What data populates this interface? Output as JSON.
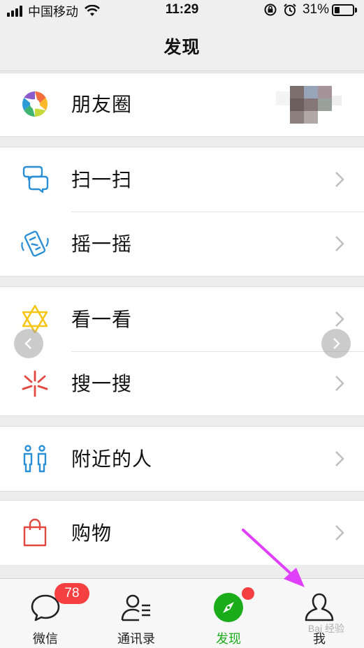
{
  "status_bar": {
    "carrier": "中国移动",
    "time": "11:29",
    "battery_percent": "31%",
    "battery_level": 0.31
  },
  "nav": {
    "title": "发现"
  },
  "menu": {
    "moments": {
      "label": "朋友圈"
    },
    "scan": {
      "label": "扫一扫"
    },
    "shake": {
      "label": "摇一摇"
    },
    "top_stories": {
      "label": "看一看"
    },
    "search": {
      "label": "搜一搜"
    },
    "nearby": {
      "label": "附近的人"
    },
    "shopping": {
      "label": "购物"
    }
  },
  "tabs": [
    {
      "label": "微信",
      "badge": "78",
      "icon": "chat-bubble-icon"
    },
    {
      "label": "通讯录",
      "icon": "contacts-icon"
    },
    {
      "label": "发现",
      "icon": "compass-icon",
      "active": true,
      "dot": true
    },
    {
      "label": "我",
      "icon": "person-icon"
    }
  ],
  "colors": {
    "accent_green": "#1aad19",
    "badge_red": "#f44040",
    "annotation_magenta": "#e040fb"
  },
  "watermark": "Bai 经验"
}
